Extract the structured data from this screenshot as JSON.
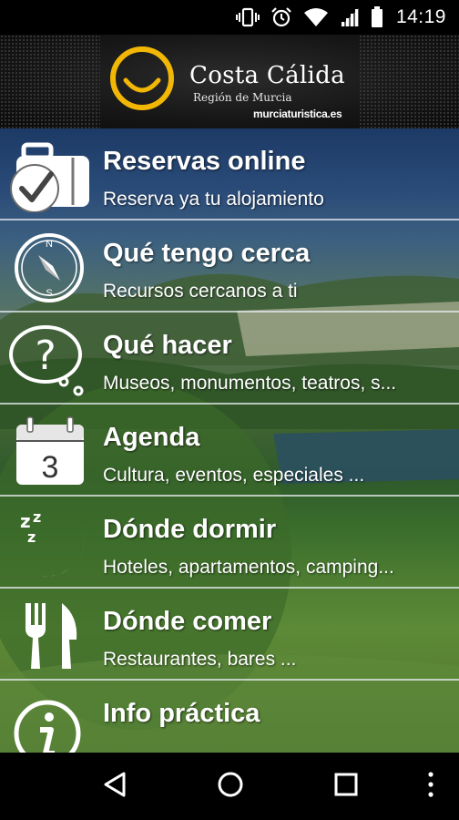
{
  "status_bar": {
    "time": "14:19",
    "icons": [
      "vibrate-icon",
      "alarm-icon",
      "wifi-icon",
      "signal-icon",
      "battery-icon"
    ]
  },
  "header": {
    "title": "Costa Cálida",
    "subtitle": "Región de Murcia",
    "url": "murciaturistica.es",
    "logo_color": "#f2b705"
  },
  "menu": {
    "items": [
      {
        "title": "Reservas online",
        "subtitle": "Reserva ya tu alojamiento",
        "icon": "suitcase-check-icon"
      },
      {
        "title": "Qué tengo cerca",
        "subtitle": "Recursos cercanos a ti",
        "icon": "compass-icon"
      },
      {
        "title": "Qué hacer",
        "subtitle": "Museos, monumentos, teatros, s...",
        "icon": "question-bubble-icon"
      },
      {
        "title": "Agenda",
        "subtitle": "Cultura, eventos, especiales ...",
        "icon": "calendar-icon",
        "calendar_day": "3"
      },
      {
        "title": "Dónde dormir",
        "subtitle": "Hoteles, apartamentos, camping...",
        "icon": "moon-sleep-icon"
      },
      {
        "title": "Dónde comer",
        "subtitle": "Restaurantes, bares ...",
        "icon": "fork-knife-icon"
      },
      {
        "title": "Info práctica",
        "subtitle": "",
        "icon": "info-icon"
      }
    ]
  },
  "nav_bar": {
    "buttons": [
      "back-icon",
      "home-icon",
      "recents-icon",
      "overflow-menu-icon"
    ]
  }
}
